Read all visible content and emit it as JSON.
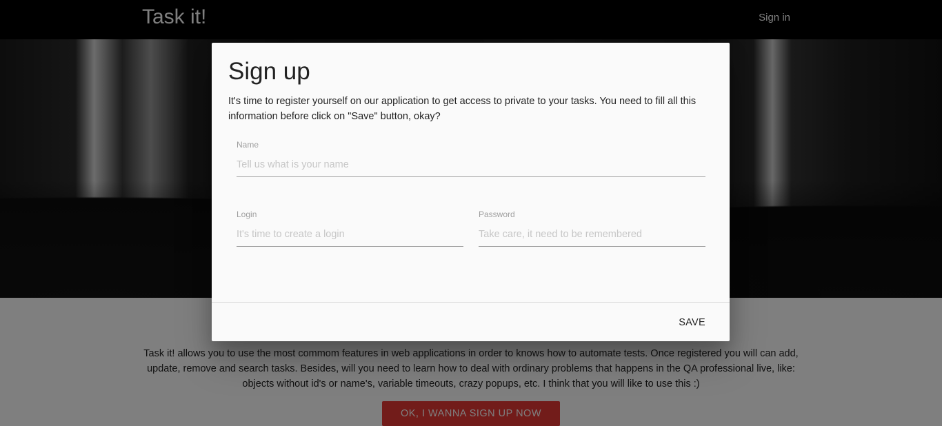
{
  "navbar": {
    "brand": "Task it!",
    "signin_label": "Sign in"
  },
  "about": {
    "text": "Task it! allows you to use the most commom features in web applications in order to knows how to automate tests. Once registered you will can add, update, remove and search tasks. Besides, will you need to learn how to deal with ordinary problems that happens in the QA professional live, like: objects without id's or name's, variable timeouts, crazy popups, etc. I think that you will like to use this :)",
    "cta_label": "OK, I WANNA SIGN UP NOW"
  },
  "modal": {
    "title": "Sign up",
    "description": "It's time to register yourself on our application to get access to private to your tasks. You need to fill all this information before click on \"Save\" button, okay?",
    "fields": {
      "name": {
        "label": "Name",
        "placeholder": "Tell us what is your name",
        "value": ""
      },
      "login": {
        "label": "Login",
        "placeholder": "It's time to create a login",
        "value": ""
      },
      "password": {
        "label": "Password",
        "placeholder": "Take care, it need to be remembered",
        "value": ""
      }
    },
    "save_label": "SAVE"
  },
  "colors": {
    "cta": "#e53935",
    "navbar": "#000000",
    "overlay": "rgba(0,0,0,0.5)"
  }
}
